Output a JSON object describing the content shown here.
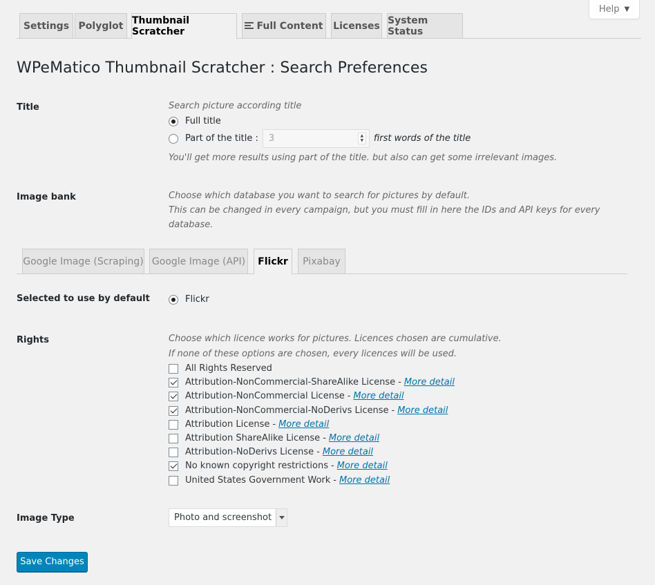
{
  "help": {
    "label": "Help"
  },
  "tabs": [
    {
      "label": "Settings"
    },
    {
      "label": "Polyglot"
    },
    {
      "label": "Thumbnail Scratcher"
    },
    {
      "label": "Full Content"
    },
    {
      "label": "Licenses"
    },
    {
      "label": "System Status"
    }
  ],
  "page_title": "WPeMatico Thumbnail Scratcher : Search Preferences",
  "title_section": {
    "label": "Title",
    "description": "Search picture according title",
    "full_title_label": "Full title",
    "part_title_label": "Part of the title :",
    "words_value": "3",
    "words_suffix": "first words of the title",
    "hint": "You'll get more results using part of the title. but also can get some irrelevant images."
  },
  "image_bank": {
    "label": "Image bank",
    "description_line1": "Choose which database you want to search for pictures by default.",
    "description_line2": "This can be changed in every campaign, but you must fill in here the IDs and API keys for every",
    "description_line3": "database."
  },
  "bank_tabs": [
    {
      "label": "Google Image (Scraping)"
    },
    {
      "label": "Google Image (API)"
    },
    {
      "label": "Flickr"
    },
    {
      "label": "Pixabay"
    }
  ],
  "default_section": {
    "label": "Selected to use by default",
    "option": "Flickr"
  },
  "rights": {
    "label": "Rights",
    "description_line1": "Choose which licence works for pictures. Licences chosen are cumulative.",
    "description_line2": "If none of these options are chosen, every licences will be used.",
    "separator": "-",
    "more_label": "More detail",
    "items": [
      {
        "label": "All Rights Reserved",
        "checked": false
      },
      {
        "label": "Attribution-NonCommercial-ShareAlike License",
        "checked": true
      },
      {
        "label": "Attribution-NonCommercial License",
        "checked": true
      },
      {
        "label": "Attribution-NonCommercial-NoDerivs License",
        "checked": true
      },
      {
        "label": "Attribution License",
        "checked": false
      },
      {
        "label": "Attribution ShareAlike License",
        "checked": false
      },
      {
        "label": "Attribution-NoDerivs License",
        "checked": false
      },
      {
        "label": "No known copyright restrictions",
        "checked": true
      },
      {
        "label": "United States Government Work",
        "checked": false
      }
    ]
  },
  "image_type": {
    "label": "Image Type",
    "selected": "Photo and screenshot"
  },
  "save_label": "Save Changes"
}
